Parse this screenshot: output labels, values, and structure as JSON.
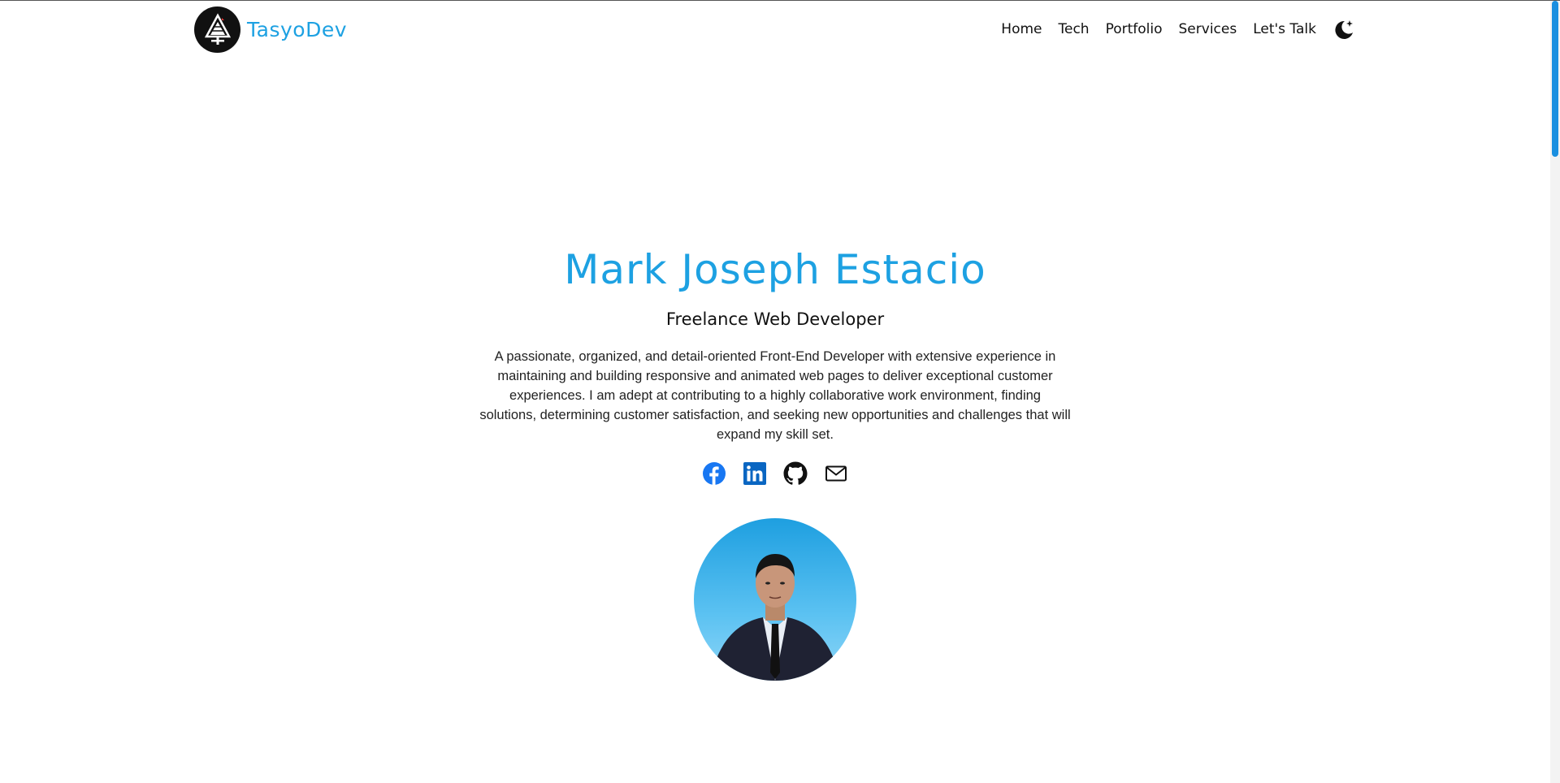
{
  "brand": {
    "name": "TasyoDev",
    "logo_icon": "tasyodev-logo-icon"
  },
  "nav": {
    "items": [
      {
        "label": "Home"
      },
      {
        "label": "Tech"
      },
      {
        "label": "Portfolio"
      },
      {
        "label": "Services"
      },
      {
        "label": "Let's Talk"
      }
    ],
    "theme_toggle_icon": "moon-stars-icon"
  },
  "hero": {
    "name": "Mark Joseph Estacio",
    "role": "Freelance Web Developer",
    "bio": "A passionate, organized, and detail-oriented Front-End Developer with extensive experience in maintaining and building responsive and animated web pages to deliver exceptional customer experiences. I am adept at contributing to a highly collaborative work environment, finding solutions, determining customer satisfaction, and seeking new opportunities and challenges that will expand my skill set.",
    "socials": [
      {
        "icon": "facebook-icon"
      },
      {
        "icon": "linkedin-icon"
      },
      {
        "icon": "github-icon"
      },
      {
        "icon": "email-icon"
      }
    ],
    "avatar_icon": "profile-photo"
  },
  "colors": {
    "accent": "#1da1e2",
    "text": "#111111",
    "facebook": "#1877f2",
    "linkedin": "#0a66c2",
    "scrollbar_thumb": "#1a8fe0"
  }
}
